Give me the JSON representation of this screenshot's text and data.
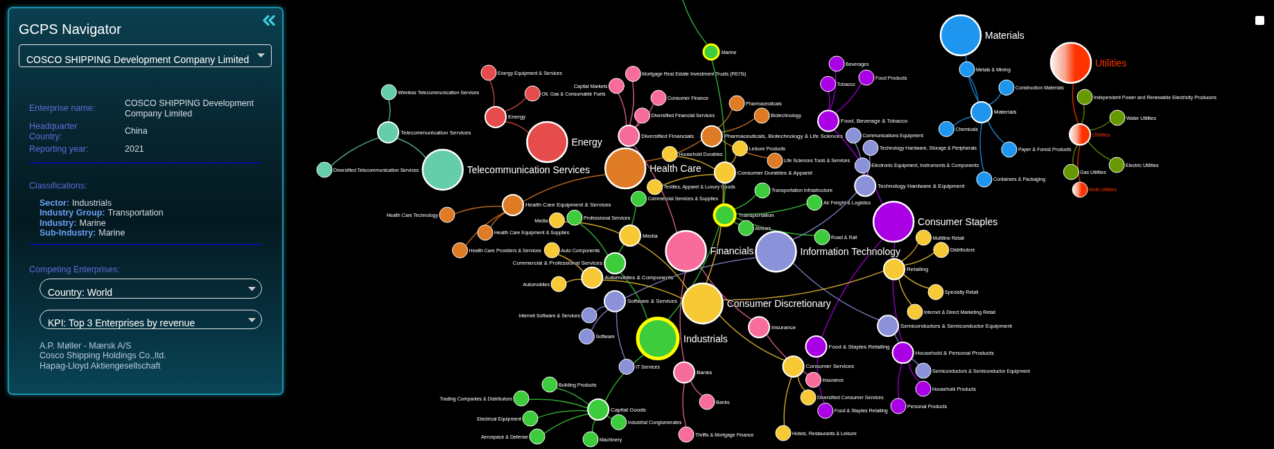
{
  "panel": {
    "title": "GCPS Navigator",
    "company_select": {
      "value": "COSCO SHIPPING Development Company Limited"
    },
    "details": [
      {
        "label": "Enterprise name:",
        "value": "COSCO SHIPPING Development Company Limited"
      },
      {
        "label": "Headquarter Country:",
        "value": "China"
      },
      {
        "label": "Reporting year:",
        "value": "2021"
      }
    ],
    "classifications": {
      "heading": "Classifications:",
      "items": [
        {
          "label": "Sector:",
          "value": "Industrials"
        },
        {
          "label": "Industry Group:",
          "value": "Transportation"
        },
        {
          "label": "Industry:",
          "value": "Marine"
        },
        {
          "label": "Sub-Industry:",
          "value": "Marine"
        }
      ]
    },
    "competing": {
      "heading": "Competing Enterprises:",
      "country_select": {
        "value": "Country: World"
      },
      "kpi_select": {
        "value": "KPI: Top 3 Enterprises by revenue"
      },
      "enterprises": [
        "A.P. Møller - Mærsk A/S",
        "Cosco Shipping Holdings Co.,ltd.",
        "Hapag-Lloyd Aktiengesellschaft"
      ]
    }
  },
  "toggle": {
    "checked": false
  },
  "graph": {
    "sectors": [
      {
        "label": "Materials",
        "color": "#1e96f0",
        "kind": "solid",
        "highlighted": false,
        "children": [
          {
            "label": "Materials",
            "color": "#1e96f0",
            "kind": "solid",
            "highlighted": false,
            "children": [
              {
                "label": "Metals & Mining",
                "color": "#1e96f0",
                "kind": "solid",
                "highlighted": false
              },
              {
                "label": "Construction Materials",
                "color": "#1e96f0",
                "kind": "solid",
                "highlighted": false
              },
              {
                "label": "Chemicals",
                "color": "#1e96f0",
                "kind": "solid",
                "highlighted": false
              },
              {
                "label": "Paper & Forest Products",
                "color": "#1e96f0",
                "kind": "solid",
                "highlighted": false
              },
              {
                "label": "Containers & Packaging",
                "color": "#1e96f0",
                "kind": "solid",
                "highlighted": false
              }
            ]
          }
        ]
      },
      {
        "label": "Utilities",
        "color": "#ff3300",
        "kind": "gradient",
        "highlighted": false,
        "children": [
          {
            "label": "Utilities",
            "color": "#ff3300",
            "kind": "gradient",
            "highlighted": false,
            "children": [
              {
                "label": "Independent Power and Renewable Electricity Producers",
                "color": "#669900",
                "kind": "solid",
                "highlighted": false
              },
              {
                "label": "Water Utilities",
                "color": "#669900",
                "kind": "solid",
                "highlighted": false
              },
              {
                "label": "Electric Utilities",
                "color": "#669900",
                "kind": "solid",
                "highlighted": false
              },
              {
                "label": "Gas Utilities",
                "color": "#669900",
                "kind": "solid",
                "highlighted": false
              },
              {
                "label": "Multi-Utilities",
                "color": "#ff3300",
                "kind": "gradient",
                "highlighted": false
              }
            ]
          }
        ]
      },
      {
        "label": "Energy",
        "color": "#e64c4c",
        "kind": "solid",
        "highlighted": false,
        "children": [
          {
            "label": "Energy",
            "color": "#e64c4c",
            "kind": "solid",
            "highlighted": false,
            "children": [
              {
                "label": "Energy Equipment & Services",
                "color": "#e64c4c",
                "kind": "solid",
                "highlighted": false
              },
              {
                "label": "Oil, Gas & Consumable Fuels",
                "color": "#e64c4c",
                "kind": "solid",
                "highlighted": false
              }
            ]
          }
        ]
      },
      {
        "label": "Health Care",
        "color": "#e07b25",
        "kind": "solid",
        "highlighted": false,
        "children": [
          {
            "label": "Pharmaceuticals, Biotechnology & Life Sciences",
            "color": "#e07b25",
            "kind": "solid",
            "highlighted": false,
            "children": [
              {
                "label": "Pharmaceuticals",
                "color": "#e07b25",
                "kind": "solid",
                "highlighted": false
              },
              {
                "label": "Biotechnology",
                "color": "#e07b25",
                "kind": "solid",
                "highlighted": false
              },
              {
                "label": "Life Sciences Tools & Services",
                "color": "#e07b25",
                "kind": "solid",
                "highlighted": false
              }
            ]
          },
          {
            "label": "Health Care Equipment & Services",
            "color": "#e07b25",
            "kind": "solid",
            "highlighted": false,
            "children": [
              {
                "label": "Health Care Technology",
                "color": "#e07b25",
                "kind": "solid",
                "highlighted": false
              },
              {
                "label": "Health Care Equipment & Supplies",
                "color": "#e07b25",
                "kind": "solid",
                "highlighted": false
              },
              {
                "label": "Health Care Providers & Services",
                "color": "#e07b25",
                "kind": "solid",
                "highlighted": false
              }
            ]
          }
        ]
      },
      {
        "label": "Telecommunication Services",
        "color": "#66cdaa",
        "kind": "solid",
        "highlighted": false,
        "children": [
          {
            "label": "Telecommunication Services",
            "color": "#66cdaa",
            "kind": "solid",
            "highlighted": false,
            "children": [
              {
                "label": "Wireless Telecommunication Services",
                "color": "#66cdaa",
                "kind": "solid",
                "highlighted": false
              },
              {
                "label": "Diversified Telecommunication Services",
                "color": "#66cdaa",
                "kind": "solid",
                "highlighted": false
              }
            ]
          }
        ]
      },
      {
        "label": "Consumer Staples",
        "color": "#aa00e5",
        "kind": "solid",
        "highlighted": false,
        "children": [
          {
            "label": "Food, Beverage & Tobacco",
            "color": "#aa00e5",
            "kind": "solid",
            "highlighted": false,
            "children": [
              {
                "label": "Beverages",
                "color": "#aa00e5",
                "kind": "solid",
                "highlighted": false
              },
              {
                "label": "Food Products",
                "color": "#aa00e5",
                "kind": "solid",
                "highlighted": false
              },
              {
                "label": "Tobacco",
                "color": "#aa00e5",
                "kind": "solid",
                "highlighted": false
              }
            ]
          },
          {
            "label": "Food & Staples Retailing",
            "color": "#aa00e5",
            "kind": "solid",
            "highlighted": false,
            "children": [
              {
                "label": "Food & Staples Retailing",
                "color": "#aa00e5",
                "kind": "solid",
                "highlighted": false
              }
            ]
          },
          {
            "label": "Household & Personal Products",
            "color": "#aa00e5",
            "kind": "solid",
            "highlighted": false,
            "children": [
              {
                "label": "Household Products",
                "color": "#aa00e5",
                "kind": "solid",
                "highlighted": false
              },
              {
                "label": "Personal Products",
                "color": "#aa00e5",
                "kind": "solid",
                "highlighted": false
              }
            ]
          }
        ]
      },
      {
        "label": "Financials",
        "color": "#f86c9c",
        "kind": "solid",
        "highlighted": false,
        "children": [
          {
            "label": "Diversified Financials",
            "color": "#f86c9c",
            "kind": "solid",
            "highlighted": false,
            "children": [
              {
                "label": "Mortgage Real Estate Investment Trusts (REITs)",
                "color": "#f86c9c",
                "kind": "solid",
                "highlighted": false
              },
              {
                "label": "Capital Markets",
                "color": "#f86c9c",
                "kind": "solid",
                "highlighted": false
              },
              {
                "label": "Consumer Finance",
                "color": "#f86c9c",
                "kind": "solid",
                "highlighted": false
              },
              {
                "label": "Diversified Financial Services",
                "color": "#f86c9c",
                "kind": "solid",
                "highlighted": false
              }
            ]
          },
          {
            "label": "Insurance",
            "color": "#f86c9c",
            "kind": "solid",
            "highlighted": false,
            "children": [
              {
                "label": "Insurance",
                "color": "#f86c9c",
                "kind": "solid",
                "highlighted": false
              }
            ]
          },
          {
            "label": "Banks",
            "color": "#f86c9c",
            "kind": "solid",
            "highlighted": false,
            "children": [
              {
                "label": "Banks",
                "color": "#f86c9c",
                "kind": "solid",
                "highlighted": false
              },
              {
                "label": "Thrifts & Mortgage Finance",
                "color": "#f86c9c",
                "kind": "solid",
                "highlighted": false
              }
            ]
          }
        ]
      },
      {
        "label": "Information Technology",
        "color": "#8c92d9",
        "kind": "solid",
        "highlighted": false,
        "children": [
          {
            "label": "Technology Hardware & Equipment",
            "color": "#8c92d9",
            "kind": "solid",
            "highlighted": false,
            "children": [
              {
                "label": "Communications Equipment",
                "color": "#8c92d9",
                "kind": "solid",
                "highlighted": false
              },
              {
                "label": "Technology Hardware, Storage & Peripherals",
                "color": "#8c92d9",
                "kind": "solid",
                "highlighted": false
              },
              {
                "label": "Electronic Equipment, Instruments & Components",
                "color": "#8c92d9",
                "kind": "solid",
                "highlighted": false
              }
            ]
          },
          {
            "label": "Software & Services",
            "color": "#8c92d9",
            "kind": "solid",
            "highlighted": false,
            "children": [
              {
                "label": "Internet Software & Services",
                "color": "#8c92d9",
                "kind": "solid",
                "highlighted": false
              },
              {
                "label": "Software",
                "color": "#8c92d9",
                "kind": "solid",
                "highlighted": false
              },
              {
                "label": "IT Services",
                "color": "#8c92d9",
                "kind": "solid",
                "highlighted": false
              }
            ]
          },
          {
            "label": "Semiconductors & Semiconductor Equipment",
            "color": "#8c92d9",
            "kind": "solid",
            "highlighted": false,
            "children": [
              {
                "label": "Semiconductors & Semiconductor Equipment",
                "color": "#8c92d9",
                "kind": "solid",
                "highlighted": false
              }
            ]
          }
        ]
      },
      {
        "label": "Consumer Discretionary",
        "color": "#f7c935",
        "kind": "solid",
        "highlighted": false,
        "children": [
          {
            "label": "Consumer Durables & Apparel",
            "color": "#f7c935",
            "kind": "solid",
            "highlighted": false,
            "children": [
              {
                "label": "Household Durables",
                "color": "#f7c935",
                "kind": "solid",
                "highlighted": false
              },
              {
                "label": "Leisure Products",
                "color": "#f7c935",
                "kind": "solid",
                "highlighted": false
              },
              {
                "label": "Textiles, Apparel & Luxury Goods",
                "color": "#f7c935",
                "kind": "solid",
                "highlighted": false
              }
            ]
          },
          {
            "label": "Media",
            "color": "#f7c935",
            "kind": "solid",
            "highlighted": false,
            "children": [
              {
                "label": "Media",
                "color": "#f7c935",
                "kind": "solid",
                "highlighted": false
              }
            ]
          },
          {
            "label": "Automobiles & Components",
            "color": "#f7c935",
            "kind": "solid",
            "highlighted": false,
            "children": [
              {
                "label": "Auto Components",
                "color": "#f7c935",
                "kind": "solid",
                "highlighted": false
              },
              {
                "label": "Automobiles",
                "color": "#f7c935",
                "kind": "solid",
                "highlighted": false
              }
            ]
          },
          {
            "label": "Retailing",
            "color": "#f7c935",
            "kind": "solid",
            "highlighted": false,
            "children": [
              {
                "label": "Multiline Retail",
                "color": "#f7c935",
                "kind": "solid",
                "highlighted": false
              },
              {
                "label": "Distributors",
                "color": "#f7c935",
                "kind": "solid",
                "highlighted": false
              },
              {
                "label": "Specialty Retail",
                "color": "#f7c935",
                "kind": "solid",
                "highlighted": false
              },
              {
                "label": "Internet & Direct Marketing Retail",
                "color": "#f7c935",
                "kind": "solid",
                "highlighted": false
              }
            ]
          },
          {
            "label": "Consumer Services",
            "color": "#f7c935",
            "kind": "solid",
            "highlighted": false,
            "children": [
              {
                "label": "Diversified Consumer Services",
                "color": "#f7c935",
                "kind": "solid",
                "highlighted": false
              },
              {
                "label": "Hotels, Restaurants & Leisure",
                "color": "#f7c935",
                "kind": "solid",
                "highlighted": false
              }
            ]
          }
        ]
      },
      {
        "label": "Industrials",
        "color": "#3ccc3c",
        "kind": "solid",
        "highlighted": true,
        "children": [
          {
            "label": "Transportation",
            "color": "#3ccc3c",
            "kind": "solid",
            "highlighted": true,
            "children": [
              {
                "label": "Marine",
                "color": "#3ccc3c",
                "kind": "solid",
                "highlighted": true
              },
              {
                "label": "Transportation Infrastructure",
                "color": "#3ccc3c",
                "kind": "solid",
                "highlighted": false
              },
              {
                "label": "Air Freight & Logistics",
                "color": "#3ccc3c",
                "kind": "solid",
                "highlighted": false
              },
              {
                "label": "Road & Rail",
                "color": "#3ccc3c",
                "kind": "solid",
                "highlighted": false
              },
              {
                "label": "Airlines",
                "color": "#3ccc3c",
                "kind": "solid",
                "highlighted": false
              }
            ]
          },
          {
            "label": "Commercial & Professional Services",
            "color": "#3ccc3c",
            "kind": "solid",
            "highlighted": false,
            "children": [
              {
                "label": "Professional Services",
                "color": "#3ccc3c",
                "kind": "solid",
                "highlighted": false
              },
              {
                "label": "Commercial Services & Supplies",
                "color": "#3ccc3c",
                "kind": "solid",
                "highlighted": false
              }
            ]
          },
          {
            "label": "Capital Goods",
            "color": "#3ccc3c",
            "kind": "solid",
            "highlighted": false,
            "children": [
              {
                "label": "Building Products",
                "color": "#3ccc3c",
                "kind": "solid",
                "highlighted": false
              },
              {
                "label": "Trading Companies & Distributors",
                "color": "#3ccc3c",
                "kind": "solid",
                "highlighted": false
              },
              {
                "label": "Electrical Equipment",
                "color": "#3ccc3c",
                "kind": "solid",
                "highlighted": false
              },
              {
                "label": "Industrial Conglomerates",
                "color": "#3ccc3c",
                "kind": "solid",
                "highlighted": false
              },
              {
                "label": "Aerospace & Defense",
                "color": "#3ccc3c",
                "kind": "solid",
                "highlighted": false
              },
              {
                "label": "Machinery",
                "color": "#3ccc3c",
                "kind": "solid",
                "highlighted": false
              }
            ]
          }
        ]
      }
    ]
  }
}
